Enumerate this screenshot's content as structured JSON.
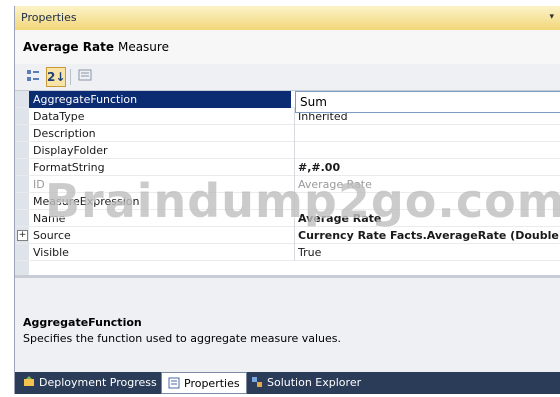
{
  "panel": {
    "title": "Properties",
    "dropdown_glyph": "▾"
  },
  "object": {
    "name": "Average Rate",
    "type": "Measure"
  },
  "toolbar": {
    "categorized_icon": "categorized-icon",
    "alphabetical_label": "2↓",
    "pages_icon": "property-pages-icon"
  },
  "edit_value": "Sum",
  "properties": [
    {
      "name": "AggregateFunction",
      "value": "",
      "selected": true
    },
    {
      "name": "DataType",
      "value": "Inherited"
    },
    {
      "name": "Description",
      "value": ""
    },
    {
      "name": "DisplayFolder",
      "value": ""
    },
    {
      "name": "FormatString",
      "value": "#,#.00",
      "bold": true
    },
    {
      "name": "ID",
      "value": "Average Rate",
      "disabled": true
    },
    {
      "name": "MeasureExpression",
      "value": ""
    },
    {
      "name": "Name",
      "value": "Average Rate",
      "bold": true
    },
    {
      "name": "Source",
      "value": "Currency Rate Facts.AverageRate (Double)",
      "bold": true,
      "expand": "+"
    },
    {
      "name": "Visible",
      "value": "True"
    }
  ],
  "description": {
    "title": "AggregateFunction",
    "text": "Specifies the function used to aggregate measure values."
  },
  "tabs": [
    {
      "label": "Deployment Progress",
      "icon": "deployment-icon"
    },
    {
      "label": "Properties",
      "icon": "properties-icon",
      "active": true
    },
    {
      "label": "Solution Explorer",
      "icon": "solution-explorer-icon"
    }
  ],
  "watermark": "Braindump2go.com"
}
